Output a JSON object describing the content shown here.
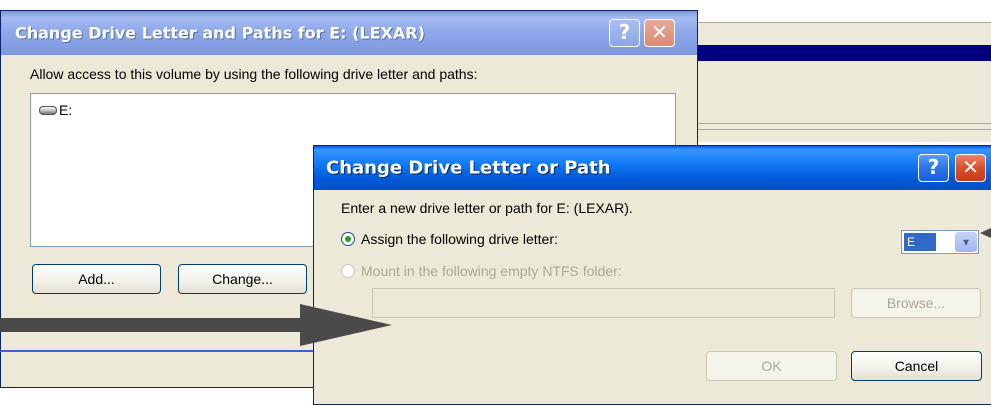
{
  "back_dialog": {
    "title": "Change Drive Letter and Paths for E: (LEXAR)",
    "help_glyph": "?",
    "close_glyph": "✕",
    "instruction": "Allow access to this volume by using the following drive letter and paths:",
    "paths": [
      {
        "icon": "drive-icon",
        "label": "E:"
      }
    ],
    "buttons": {
      "add": "Add...",
      "change": "Change..."
    }
  },
  "front_dialog": {
    "title": "Change Drive Letter or Path",
    "help_glyph": "?",
    "close_glyph": "✕",
    "instruction": "Enter a new drive letter or path for E: (LEXAR).",
    "assign_option": {
      "label": "Assign the following drive letter:",
      "checked": true
    },
    "drive_letter": {
      "value": "E",
      "arrow_glyph": "▾"
    },
    "mount_option": {
      "label": "Mount in the following empty NTFS folder:",
      "checked": false,
      "enabled": false
    },
    "folder_path": {
      "value": ""
    },
    "buttons": {
      "browse": "Browse...",
      "ok": "OK",
      "cancel": "Cancel"
    }
  },
  "colors": {
    "dialog_face": "#ECE9D8",
    "title_active": "#0058EE",
    "arrow_annotation": "#4A4A4A"
  }
}
